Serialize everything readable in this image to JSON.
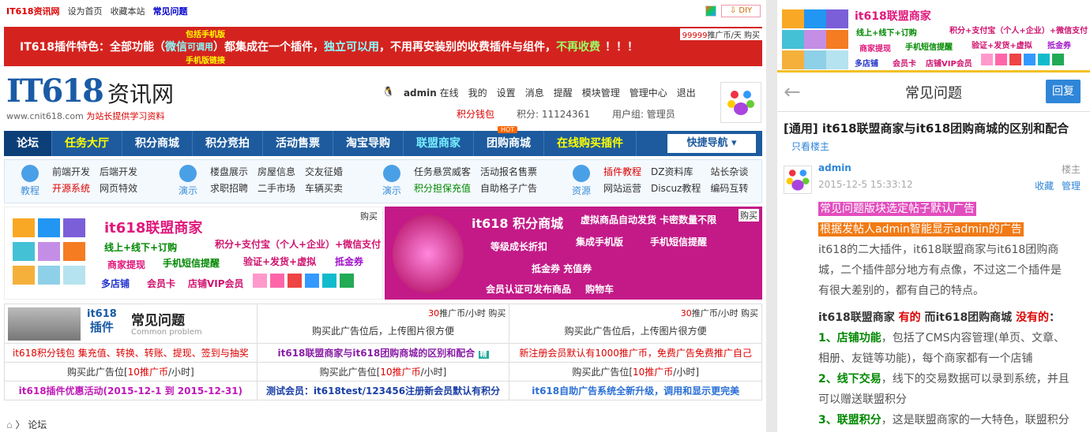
{
  "topbar": {
    "logo": "IT618资讯网",
    "sethome": "设为首页",
    "fav": "收藏本站",
    "faq": "常见问题",
    "diy": "⇩ DIY"
  },
  "banner": {
    "prefix": "IT618插件特色：全部功能（",
    "weixin": "微信",
    "keyong": "可调用",
    "mid": "）都集成在一个插件，",
    "indep": "独立可以用",
    "tail": "，不用再安装别的收费插件与组件，",
    "free": "不再收费",
    "bang": "！！！",
    "mobile": "包括手机版",
    "mobile_link": "手机版链接",
    "ad_price": "99999",
    "ad_unit": "推广币",
    "ad_tail": "/天 购买"
  },
  "brand": {
    "name": "IT618",
    "suffix": "资讯网",
    "url": "www.cnit618.com",
    "slogan": "为站长提供学习资料"
  },
  "user": {
    "name": "admin",
    "status": "在线",
    "my": "我的",
    "settings": "设置",
    "msg": "消息",
    "remind": "提醒",
    "modules": "模块管理",
    "center": "管理中心",
    "logout": "退出",
    "wallet": "积分钱包",
    "points": "积分: 11124361",
    "group": "用户组: 管理员"
  },
  "nav": {
    "items": [
      "论坛",
      "任务大厅",
      "积分商城",
      "积分竞拍",
      "活动售票",
      "淘宝导购",
      "联盟商家",
      "团购商城",
      "在线购买插件"
    ],
    "quick": "快捷导航 ▾",
    "hot": "HOT"
  },
  "cats": [
    {
      "icon": "教程",
      "links": [
        "前端开发",
        "后端开发",
        "",
        "开源系统",
        "网页特效",
        ""
      ]
    },
    {
      "icon": "演示",
      "links": [
        "楼盘展示",
        "房屋信息",
        "交友征婚",
        "求职招聘",
        "二手市场",
        "车辆买卖"
      ]
    },
    {
      "icon": "演示",
      "links": [
        "任务悬赏威客",
        "活动报名售票",
        "",
        "积分担保充值",
        "自助格子广告",
        ""
      ]
    },
    {
      "icon": "资源",
      "links": [
        "插件教程",
        "DZ资料库",
        "站长杂谈",
        "网站运营",
        "Discuz教程",
        "编码互转"
      ]
    }
  ],
  "ad_left": {
    "title": "it618联盟商家",
    "l1": "线上+线下+订购",
    "l2": "积分+支付宝（个人+企业）+微信支付",
    "l3a": "商家提现",
    "l3b": "手机短信提醒",
    "l3c": "验证+发货+虚拟",
    "l3d": "抵金券",
    "l4a": "多店铺",
    "l4b": "会员卡",
    "l4c": "店铺VIP会员",
    "buy": "购买"
  },
  "ad_right": {
    "title": "it618 积分商城",
    "l1": "虚拟商品自动发货 卡密数量不限",
    "l2a": "等级成长折扣",
    "l2b": "集成手机版",
    "l2c": "手机短信提醒",
    "l3": "抵金券 充值券",
    "l4a": "会员认证可发布商品",
    "l4b": "购物车",
    "buy": "购买"
  },
  "grid": {
    "faq_a": "it618",
    "faq_b": "插件",
    "faq_title": "常见问题",
    "faq_sub": "Common problem",
    "ad30": "30",
    "ad30_unit": "推广币",
    "ad30_tail": "/小时 购买",
    "buyimg": "购买此广告位后，上传图片很方便",
    "r2": [
      "it618积分钱包 集充值、转换、转账、提现、签到与抽奖",
      "it618联盟商家与it618团购商城的区别和配合",
      "新注册会员默认有1000推广币，免费广告免费推广自己"
    ],
    "r2_badge": "精",
    "r3_pre": "购买此广告位[",
    "r3_num": "10",
    "r3_unit": "推广币",
    "r3_post": "/小时]",
    "r4": [
      "it618插件优惠活动(2015-12-1 到 2015-12-31)",
      "测试会员：it618test/123456注册新会员默认有积分",
      "it618自助广告系统全新升级，调用和显示更完美"
    ]
  },
  "crumb": "论坛",
  "right": {
    "title": "常见问题",
    "reply": "回复",
    "post_title": "[通用] it618联盟商家与it618团购商城的区别和配合",
    "only": "只看楼主",
    "author": "admin",
    "floor": "楼主",
    "time": "2015-12-5 15:33:12",
    "collect": "收藏",
    "manage": "管理",
    "hl1": "常见问题版块选定帖子默认广告",
    "hl2": "根据发帖人admin智能显示admin的广告",
    "p1": "it618的二大插件，it618联盟商家与it618团购商城，二个插件部分地方有点像，不过这二个插件是有很大差别的，都有自己的特点。",
    "p2a": "it618联盟商家",
    "p2b": "有的",
    "p2c": "而it618团购商城",
    "p2d": "没有的",
    "i1a": "1、店铺功能",
    "i1b": "，包括了CMS内容管理(单页、文章、相册、友链等功能)，每个商家都有一个店铺",
    "i2a": "2、线下交易",
    "i2b": "，线下的交易数据可以录到系统，并且可以赠送联盟积分",
    "i3a": "3、联盟积分",
    "i3b": "，这是联盟商家的一大特色，联盟积分全联盟通用，线上现金交易与线下交易都可以赠"
  },
  "colors": {
    "nav": "#1d5b9e",
    "banner": "#d4231f",
    "mall": "#c31a88",
    "accent": "#2f86d8"
  }
}
